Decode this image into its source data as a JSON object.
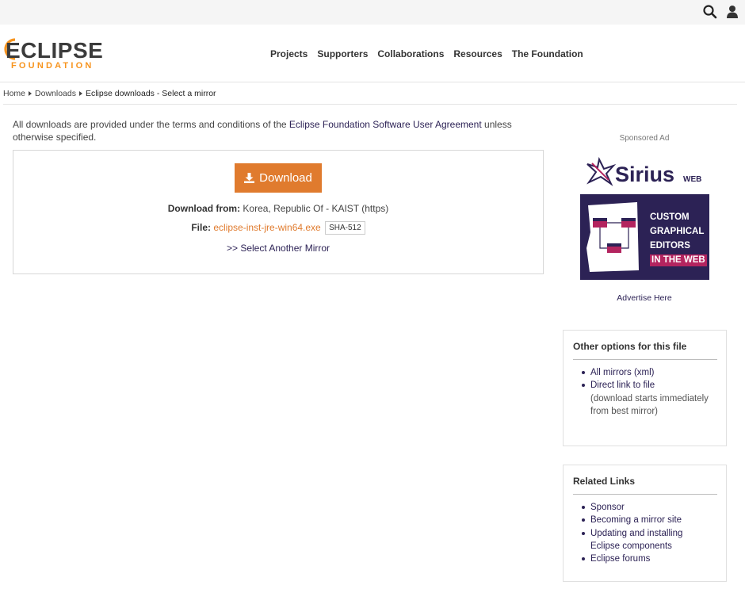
{
  "utility": {
    "search_icon": "search-icon",
    "user_icon": "user-icon"
  },
  "header": {
    "logo_main": "ECLIPSE",
    "logo_sub": "FOUNDATION",
    "nav": [
      "Projects",
      "Supporters",
      "Collaborations",
      "Resources",
      "The Foundation"
    ]
  },
  "breadcrumb": {
    "home": "Home",
    "downloads": "Downloads",
    "current": "Eclipse downloads - Select a mirror"
  },
  "intro": {
    "prefix": "All downloads are provided under the terms and conditions of the ",
    "link": "Eclipse Foundation Software User Agreement",
    "suffix": " unless otherwise specified."
  },
  "download": {
    "button_label": "Download",
    "from_label": "Download from:",
    "from_value": "Korea, Republic Of - KAIST (https)",
    "file_label": "File:",
    "file_name": "eclipse-inst-jre-win64.exe",
    "sha_label": "SHA-512",
    "select_mirror": ">> Select Another Mirror"
  },
  "sidebar": {
    "ad_label": "Sponsored Ad",
    "ad_brand": "Sirius",
    "ad_brand_suffix": "WEB",
    "ad_lines": [
      "CUSTOM",
      "GRAPHICAL",
      "EDITORS"
    ],
    "ad_highlight": "IN THE WEB",
    "advertise": "Advertise Here",
    "options": {
      "title": "Other options for this file",
      "items": [
        {
          "link": "All mirrors (xml)",
          "note": ""
        },
        {
          "link": "Direct link to file",
          "note": "(download starts immediately from best mirror)"
        }
      ]
    },
    "related": {
      "title": "Related Links",
      "items": [
        "Sponsor",
        "Becoming a mirror site",
        "Updating and installing Eclipse components",
        "Eclipse forums"
      ]
    }
  },
  "colors": {
    "accent_orange": "#e07b2e",
    "link_purple": "#2c2255",
    "ad_pink": "#b3245f"
  }
}
